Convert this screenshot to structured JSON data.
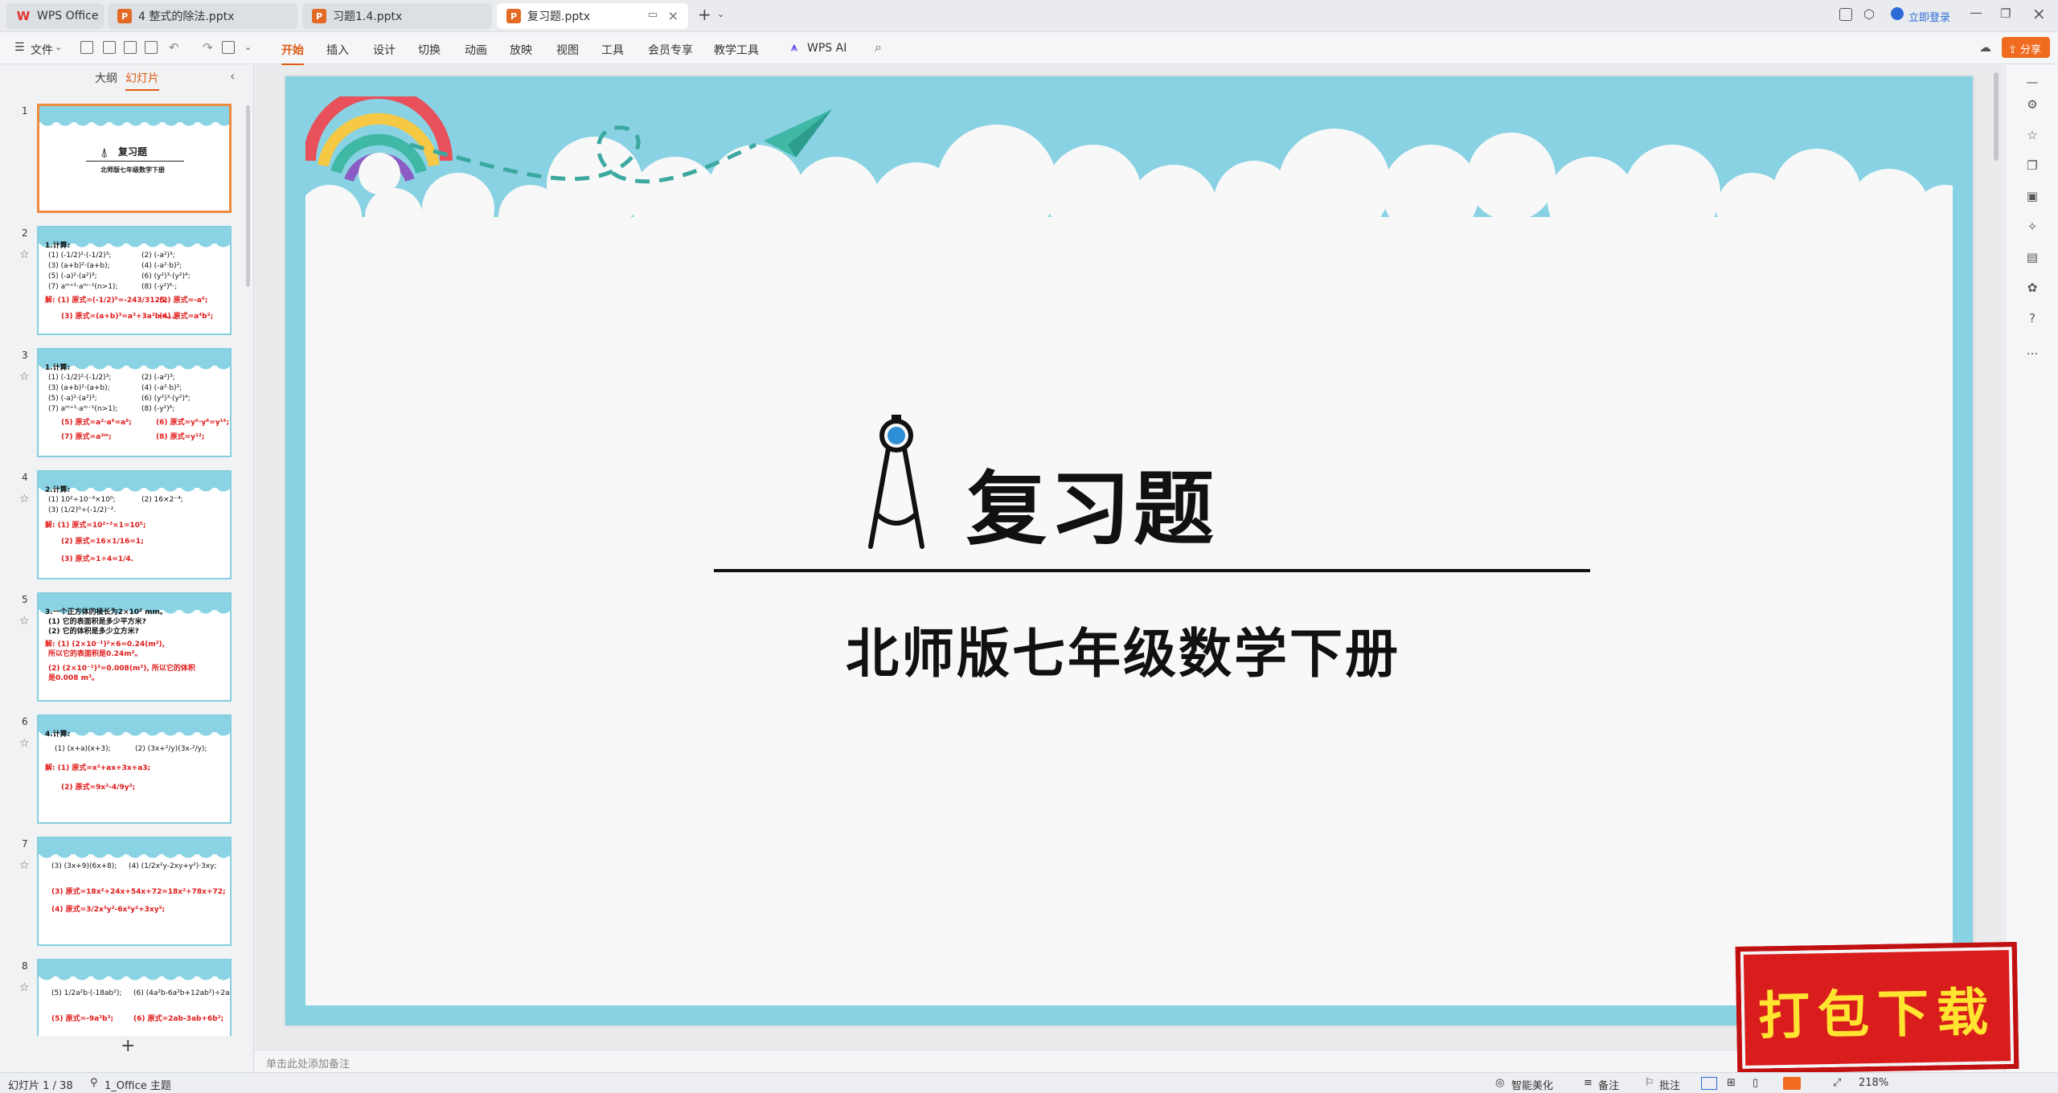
{
  "tabs": [
    {
      "label": "WPS Office"
    },
    {
      "label": "4  整式的除法.pptx"
    },
    {
      "label": "习题1.4.pptx"
    },
    {
      "label": "复习题.pptx"
    }
  ],
  "titlebar": {
    "login": "立即登录"
  },
  "ribbon": {
    "file": "文件",
    "items": [
      "开始",
      "插入",
      "设计",
      "切换",
      "动画",
      "放映",
      "视图",
      "工具",
      "会员专享",
      "教学工具"
    ],
    "wps_ai": "WPS AI",
    "share": "分享"
  },
  "left_panel": {
    "tabs": [
      "大纲",
      "幻灯片"
    ],
    "thumbs": [
      {
        "num": "1"
      },
      {
        "num": "2"
      },
      {
        "num": "3"
      },
      {
        "num": "4"
      },
      {
        "num": "5"
      },
      {
        "num": "6"
      },
      {
        "num": "7"
      },
      {
        "num": "8"
      }
    ],
    "thumb1": {
      "title": "复习题",
      "subtitle": "北师版七年级数学下册"
    },
    "thumb2": [
      "1.计算:",
      "(1) (-1/2)²·(-1/2)³;",
      "(2) (-a²)³;",
      "(3) (a+b)²·(a+b);",
      "(4) (-a²·b)²;",
      "(5) (-a)²·(a²)³;",
      "(6) (y²)³·(y²)⁴;",
      "(7) aᵐ⁺¹·aᵐ⁻¹(n>1);",
      "(8) (-y²)⁶·;"
    ],
    "thumb2_ans": [
      "解: (1) 原式=(-1/2)⁵=-243/3125;",
      "(2) 原式=-a⁶;",
      "(3) 原式=(a+b)³=a³+3a²b+...;",
      "(4) 原式=a⁴b²;"
    ],
    "thumb3": [
      "1.计算:",
      "(1) (-1/2)²·(-1/2)³;",
      "(2) (-a²)³;",
      "(3) (a+b)²·(a+b);",
      "(4) (-a²·b)²;",
      "(5) (-a)²·(a²)³;",
      "(6) (y²)³·(y²)⁴;",
      "(7) aᵐ⁺¹·aᵐ⁻¹(n>1);",
      "(8) (-y²)⁶;"
    ],
    "thumb3_ans": [
      "(5) 原式=a²·a⁶=a⁸;",
      "(6) 原式=y⁶·y⁸=y¹⁴;",
      "(7) 原式=a²ᵐ;",
      "(8) 原式=y¹²;"
    ],
    "thumb4": [
      "2.计算:",
      "(1) 10²÷10⁻³×10⁰;",
      "(2) 16×2⁻⁴;",
      "(3) (1/2)⁰÷(-1/2)⁻²."
    ],
    "thumb4_ans": [
      "解: (1) 原式=10²⁺³×1=10⁵;",
      "(2) 原式=16×1/16=1;",
      "(3) 原式=1÷4=1/4."
    ],
    "thumb5": [
      "3.一个正方体的棱长为2×10² mm。",
      "(1) 它的表面积是多少平方米?",
      "(2) 它的体积是多少立方米?"
    ],
    "thumb5_ans": [
      "解: (1) (2×10⁻¹)²×6=0.24(m²),",
      "所以它的表面积是0.24m²。",
      "(2) (2×10⁻¹)³=0.008(m³), 所以它的体积",
      "是0.008 m³。"
    ],
    "thumb6": [
      "4.计算:",
      "(1) (x+a)(x+3);",
      "(2) (3x+²/y)(3x-²/y);"
    ],
    "thumb6_ans": [
      "解: (1) 原式=x²+ax+3x+a3;",
      "(2) 原式=9x²-4/9y²;"
    ],
    "thumb7": [
      "(3) (3x+9)(6x+8);",
      "(4) (1/2x²y-2xy+y²)·3xy;"
    ],
    "thumb7_ans": [
      "(3) 原式=18x²+24x+54x+72=18x²+78x+72;",
      "(4) 原式=3/2x³y²-6x²y²+3xy³;"
    ],
    "thumb8": [
      "(5) 1/2a²b·(-18ab²);",
      "(6) (4a²b-6a²b+12ab²)÷2a;"
    ],
    "thumb8_ans": [
      "(5) 原式=-9a³b³;",
      "(6) 原式=2ab-3ab+6b²;"
    ],
    "add": "+"
  },
  "slide": {
    "title": "复习题",
    "subtitle": "北师版七年级数学下册"
  },
  "notes_placeholder": "单击此处添加备注",
  "status": {
    "slide_count": "幻灯片 1 / 38",
    "theme": "1_Office 主题",
    "beautify": "智能美化",
    "notes": "备注",
    "comment": "批注",
    "zoom": "218%"
  },
  "promo": {
    "text": "打包下载"
  },
  "colors": {
    "accent": "#e05a12",
    "sky": "#89d2e3",
    "answer_red": "#e01919"
  }
}
